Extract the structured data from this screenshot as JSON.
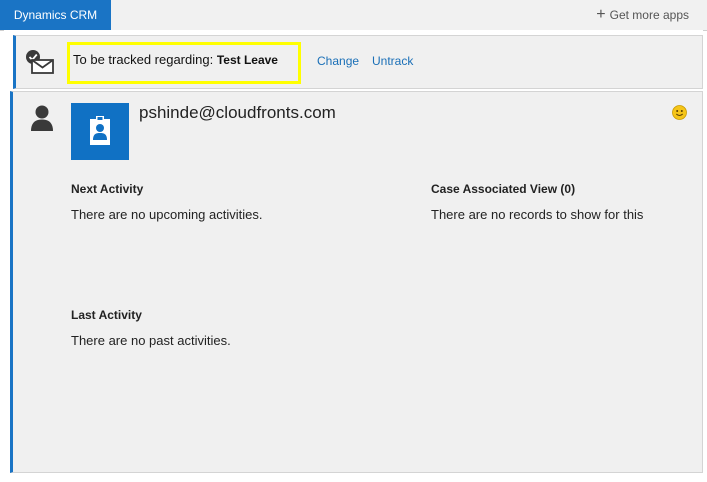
{
  "tabs": {
    "active_label": "Dynamics CRM",
    "get_more_label": "Get more apps"
  },
  "tracking": {
    "prefix": "To be tracked regarding:",
    "record": "Test Leave",
    "change_label": "Change",
    "untrack_label": "Untrack",
    "highlight_color": "#ffff00"
  },
  "contact": {
    "email": "pshinde@cloudfronts.com"
  },
  "sections": {
    "next_activity_title": "Next Activity",
    "next_activity_text": "There are no upcoming activities.",
    "case_view_title": "Case Associated View (0)",
    "case_view_text": "There are no records to show for this",
    "last_activity_title": "Last Activity",
    "last_activity_text": "There are no past activities."
  },
  "colors": {
    "accent": "#1a74c5",
    "panel_bg": "#f0f0f0",
    "link": "#1a6fb7"
  },
  "icons": [
    "plus-icon",
    "tracked-mail-icon",
    "person-icon",
    "contact-card-icon",
    "smiley-icon"
  ]
}
